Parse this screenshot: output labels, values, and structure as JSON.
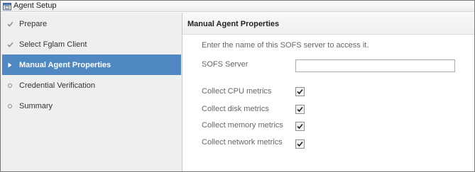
{
  "window": {
    "title": "Agent Setup",
    "icon": "wizard-icon"
  },
  "steps": [
    {
      "label": "Prepare",
      "state": "done",
      "icon": "check-icon"
    },
    {
      "label": "Select Fglam Client",
      "state": "done",
      "icon": "check-icon"
    },
    {
      "label": "Manual Agent Properties",
      "state": "active",
      "icon": "arrow-right-icon"
    },
    {
      "label": "Credential Verification",
      "state": "pending",
      "icon": "circle-icon"
    },
    {
      "label": "Summary",
      "state": "pending",
      "icon": "circle-icon"
    }
  ],
  "panel": {
    "title": "Manual Agent Properties",
    "instruction": "Enter the name of this SOFS server to access it.",
    "sofs_server": {
      "label": "SOFS Server",
      "value": "",
      "placeholder": ""
    },
    "metrics": [
      {
        "label": "Collect CPU metrics",
        "checked": true
      },
      {
        "label": "Collect disk metrics",
        "checked": true
      },
      {
        "label": "Collect memory metrics",
        "checked": true
      },
      {
        "label": "Collect network metrics",
        "checked": true
      }
    ]
  },
  "colors": {
    "active_step_bg": "#4f88c3",
    "sidebar_bg": "#efefef",
    "label_text": "#666666"
  }
}
